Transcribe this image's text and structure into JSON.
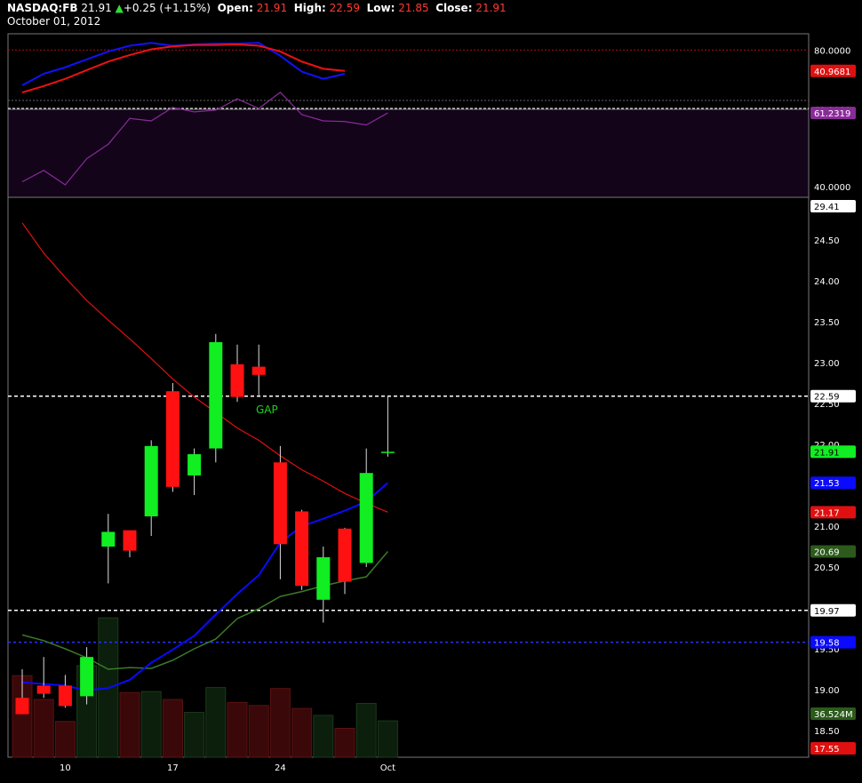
{
  "header": {
    "symbol": "NASDAQ:FB",
    "last": "21.91",
    "change": "+0.25 (+1.15%)",
    "open_label": "Open:",
    "open": "21.91",
    "high_label": "High:",
    "high": "22.59",
    "low_label": "Low:",
    "low": "21.85",
    "close_label": "Close:",
    "close": "21.91",
    "date": "October 01, 2012"
  },
  "colors": {
    "up": "#11ee22",
    "down": "#ff1111",
    "ema_fast": "#0a0aff",
    "ema_slow": "#e01010",
    "sma": "#3a7a26",
    "stoch_k": "#1111ff",
    "stoch_d": "#ee1111",
    "rsi": "#8a2b9a",
    "rsi_bg": "#13041a"
  },
  "chart_data": {
    "type": "candlestick",
    "x_tick_labels": [
      "10",
      "17",
      "24",
      "Oct"
    ],
    "y_tick_labels": [
      "18.50",
      "19.00",
      "19.50",
      "20.00",
      "20.50",
      "21.00",
      "21.50",
      "22.00",
      "22.50",
      "23.00",
      "23.50",
      "24.00",
      "24.50"
    ],
    "candles": [
      {
        "o": 18.9,
        "h": 19.25,
        "l": 18.7,
        "c": 18.7
      },
      {
        "o": 19.05,
        "h": 19.4,
        "l": 18.9,
        "c": 18.95
      },
      {
        "o": 19.05,
        "h": 19.18,
        "l": 18.78,
        "c": 18.8
      },
      {
        "o": 18.92,
        "h": 19.52,
        "l": 18.82,
        "c": 19.4
      },
      {
        "o": 20.75,
        "h": 21.15,
        "l": 20.3,
        "c": 20.93
      },
      {
        "o": 20.95,
        "h": 20.95,
        "l": 20.62,
        "c": 20.7
      },
      {
        "o": 21.12,
        "h": 22.05,
        "l": 20.88,
        "c": 21.98
      },
      {
        "o": 22.65,
        "h": 22.75,
        "l": 21.42,
        "c": 21.48
      },
      {
        "o": 21.62,
        "h": 21.95,
        "l": 21.38,
        "c": 21.88
      },
      {
        "o": 21.95,
        "h": 23.35,
        "l": 21.78,
        "c": 23.25
      },
      {
        "o": 22.98,
        "h": 23.22,
        "l": 22.52,
        "c": 22.58
      },
      {
        "o": 22.95,
        "h": 23.22,
        "l": 22.6,
        "c": 22.85
      },
      {
        "o": 21.78,
        "h": 21.98,
        "l": 20.35,
        "c": 20.78
      },
      {
        "o": 21.18,
        "h": 21.2,
        "l": 20.22,
        "c": 20.27
      },
      {
        "o": 20.1,
        "h": 20.75,
        "l": 19.82,
        "c": 20.62
      },
      {
        "o": 20.97,
        "h": 20.98,
        "l": 20.17,
        "c": 20.32
      },
      {
        "o": 20.55,
        "h": 21.95,
        "l": 20.5,
        "c": 21.65
      },
      {
        "o": 21.9,
        "h": 22.59,
        "l": 21.85,
        "c": 21.91
      }
    ],
    "volume_mil": [
      82,
      58,
      36,
      92,
      140,
      65,
      66,
      58,
      45,
      70,
      55,
      52,
      69,
      49,
      42,
      29,
      54,
      36.524
    ],
    "ema_fast": [
      19.09,
      19.07,
      19.05,
      18.99,
      19.02,
      19.12,
      19.33,
      19.49,
      19.66,
      19.92,
      20.17,
      20.4,
      20.8,
      21.0,
      21.09,
      21.19,
      21.3,
      21.53
    ],
    "ema_slow": [
      24.71,
      24.34,
      24.04,
      23.76,
      23.52,
      23.29,
      23.05,
      22.8,
      22.58,
      22.39,
      22.2,
      22.05,
      21.86,
      21.69,
      21.55,
      21.4,
      21.28,
      21.17
    ],
    "sma": [
      19.67,
      19.6,
      19.5,
      19.39,
      19.25,
      19.27,
      19.26,
      19.36,
      19.5,
      19.62,
      19.87,
      19.99,
      20.14,
      20.2,
      20.27,
      20.33,
      20.38,
      20.69
    ],
    "stochastic": {
      "label_ticks": [
        "80.0000"
      ],
      "current": "40.9681",
      "k": [
        21,
        37,
        46,
        57,
        68,
        76,
        80,
        76,
        78,
        79,
        79,
        80,
        62,
        40,
        30,
        37
      ],
      "d": [
        11,
        20,
        30,
        42,
        54,
        63,
        71,
        75,
        77,
        77,
        78,
        76,
        68,
        54,
        44,
        41
      ]
    },
    "rsi": {
      "label_ticks": [
        "60.0000",
        "40.0000"
      ],
      "current": "61.2319",
      "values": [
        41.3,
        44.6,
        40.4,
        48.0,
        52.2,
        59.7,
        59.0,
        62.9,
        61.6,
        62.1,
        65.4,
        62.6,
        67.3,
        60.8,
        59.0,
        58.8,
        57.8,
        61.3
      ]
    },
    "price_labels": {
      "top": "29.41",
      "resistance": "22.59",
      "last": "21.91",
      "ema_fast": "21.53",
      "ema_slow": "21.17",
      "sma": "20.69",
      "support": "19.97",
      "blue_line": "19.58",
      "volume": "36.524M",
      "bottom": "17.55"
    },
    "levels": {
      "resistance": 22.59,
      "support": 19.97,
      "blue_line": 19.58
    },
    "annotation": "GAP"
  }
}
